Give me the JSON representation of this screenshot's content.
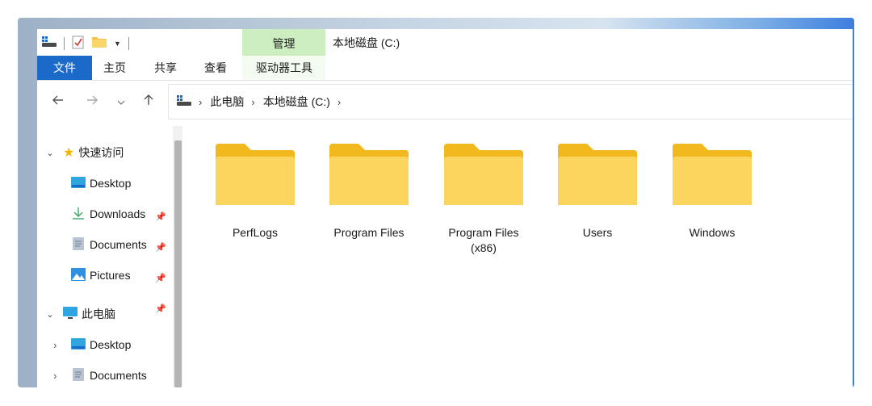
{
  "window": {
    "title": "本地磁盘 (C:)"
  },
  "ribbon": {
    "context_tab": "管理",
    "tabs": [
      "文件",
      "主页",
      "共享",
      "查看",
      "驱动器工具"
    ]
  },
  "address_bar": {
    "crumbs": [
      "此电脑",
      "本地磁盘 (C:)"
    ]
  },
  "sidebar": {
    "quick_access": "快速访问",
    "pinned": [
      {
        "label": "Desktop",
        "icon": "desktop-folder-icon"
      },
      {
        "label": "Downloads",
        "icon": "download-icon"
      },
      {
        "label": "Documents",
        "icon": "documents-icon"
      },
      {
        "label": "Pictures",
        "icon": "pictures-icon"
      }
    ],
    "this_pc": "此电脑",
    "pc_items": [
      {
        "label": "Desktop",
        "icon": "desktop-folder-icon"
      },
      {
        "label": "Documents",
        "icon": "documents-icon"
      }
    ]
  },
  "folders": [
    {
      "line1": "PerfLogs",
      "line2": ""
    },
    {
      "line1": "Program Files",
      "line2": ""
    },
    {
      "line1": "Program Files",
      "line2": "(x86)"
    },
    {
      "line1": "Users",
      "line2": ""
    },
    {
      "line1": "Windows",
      "line2": ""
    }
  ],
  "colors": {
    "accent": "#1b6ac9",
    "context_tab": "#cdeec0",
    "folder": "#f9cf4e"
  }
}
